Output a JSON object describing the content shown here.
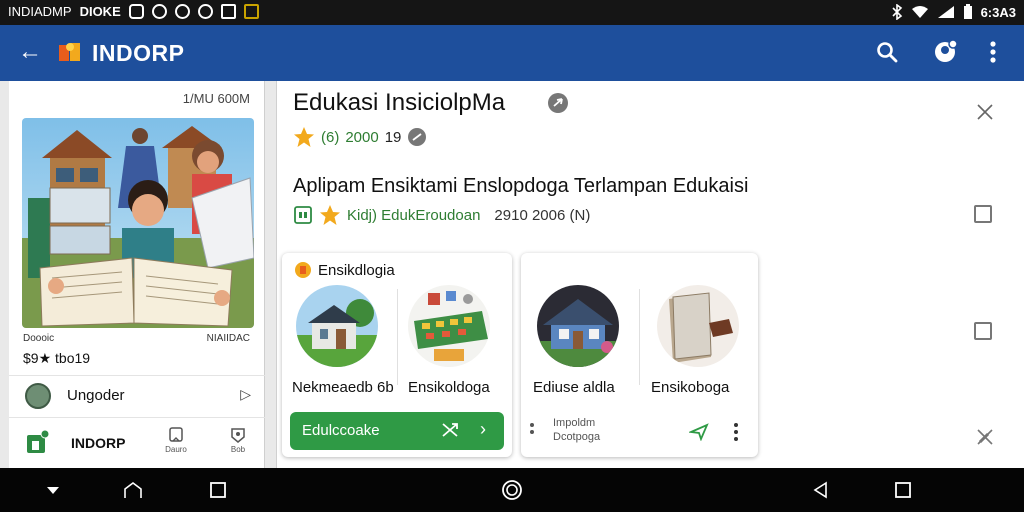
{
  "status_bar": {
    "left_text": "INDIADMP",
    "left_text2": "DIOKE",
    "time": "6:3A3"
  },
  "app_bar": {
    "back_icon": "arrow-left-icon",
    "title": "INDORP",
    "actions": [
      "search-icon",
      "account-icon",
      "more-vert-icon"
    ]
  },
  "side_card": {
    "meta": "1/MU 600M",
    "caption_left": "Doooic",
    "caption_right": "NIAIIDAC",
    "rating_text": "$9★ tbo19",
    "user_name": "Ungoder",
    "bottom_nav": {
      "home_label": "INDORP",
      "tab1_label": "Dauro",
      "tab2_label": "Bob"
    }
  },
  "main": {
    "title": "Edukasi InsiciolpMa",
    "rating_row": {
      "prefix": "(6)",
      "value": "2000",
      "count": "19"
    },
    "subtitle": "Aplipam Ensiktami Enslopdoga Terlampan Edukaisi",
    "category_row": {
      "category": "Kidj) EdukEroudoan",
      "years": "2910 2006 (N)"
    }
  },
  "card1": {
    "header": "Ensikdlogia",
    "item1_label": "Nekmeaedb 6b",
    "item2_label": "Ensikoldoga",
    "button_label": "Edulccoake"
  },
  "card2": {
    "item1_label": "Ediuse aldla",
    "item2_label": "Ensikoboga",
    "info_line1": "Impoldm",
    "info_line2": "Dcotpoga"
  },
  "colors": {
    "app_bar": "#1e4f9c",
    "accent_green": "#2f9a45",
    "status_bar": "#151515",
    "nav_bar": "#050505",
    "star": "#f2a91d"
  },
  "system_nav": [
    "down-chevron-icon",
    "home-outline-icon",
    "square-icon",
    "circle-home-icon",
    "back-triangle-icon",
    "recents-square-icon"
  ]
}
